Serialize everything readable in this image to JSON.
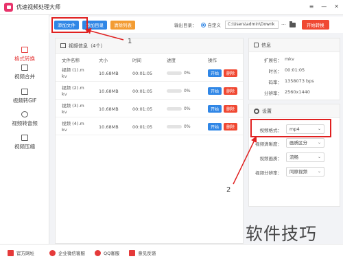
{
  "window": {
    "title": "优速视频处理大师",
    "controls": [
      "≡",
      "—",
      "✕"
    ]
  },
  "toolbar": {
    "add_file": "添加文件",
    "add_folder": "添加目录",
    "clear_list": "清除列表",
    "output_label": "输出目录：",
    "radio_label": "自定义",
    "output_path": "C:\\Users\\admin\\Downk",
    "browse": "···",
    "start": "开始转换"
  },
  "sidebar": {
    "items": [
      {
        "label": "格式转换",
        "active": true
      },
      {
        "label": "视频合并"
      },
      {
        "label": "视频转GIF"
      },
      {
        "label": "视频转音频"
      },
      {
        "label": "视频压缩"
      }
    ]
  },
  "video_panel": {
    "title": "视频信息（4个）",
    "columns": [
      "文件名称",
      "大小",
      "时间",
      "进度",
      "操作"
    ],
    "rows": [
      {
        "name_line1": "视频 (1).m",
        "name_line2": "kv",
        "size": "10.68MB",
        "time": "00:01:05",
        "progress": "0%",
        "start": "开始",
        "delete": "删除"
      },
      {
        "name_line1": "视频 (2).m",
        "name_line2": "kv",
        "size": "10.68MB",
        "time": "00:01:05",
        "progress": "0%",
        "start": "开始",
        "delete": "删除"
      },
      {
        "name_line1": "视频 (3).m",
        "name_line2": "kv",
        "size": "10.68MB",
        "time": "00:01:05",
        "progress": "0%",
        "start": "开始",
        "delete": "删除"
      },
      {
        "name_line1": "视频 (4).m",
        "name_line2": "kv",
        "size": "10.68MB",
        "time": "00:01:05",
        "progress": "0%",
        "start": "开始",
        "delete": "删除"
      }
    ]
  },
  "info_panel": {
    "title": "信息",
    "rows": [
      {
        "key": "扩展名：",
        "value": "mkv"
      },
      {
        "key": "时长：",
        "value": "00:01:05"
      },
      {
        "key": "码率：",
        "value": "1358073 bps"
      },
      {
        "key": "分辨率：",
        "value": "2560x1440"
      }
    ]
  },
  "settings_panel": {
    "title": "设置",
    "rows": [
      {
        "key": "视频格式：",
        "value": "mp4"
      },
      {
        "key": "视频清晰度：",
        "value": "画质区分"
      },
      {
        "key": "视频画质：",
        "value": "流畅"
      },
      {
        "key": "视频分辨率：",
        "value": "同原视频"
      }
    ]
  },
  "annotations": {
    "label_1": "1",
    "label_2": "2"
  },
  "footer": {
    "items": [
      "官方网址",
      "企业微信客服",
      "QQ客服",
      "意见反馈"
    ]
  },
  "watermark": "软件技巧",
  "colors": {
    "accent_blue": "#2f86e6",
    "accent_red": "#f04832",
    "annotation_red": "#e02020",
    "clear_orange": "#f39c33"
  }
}
